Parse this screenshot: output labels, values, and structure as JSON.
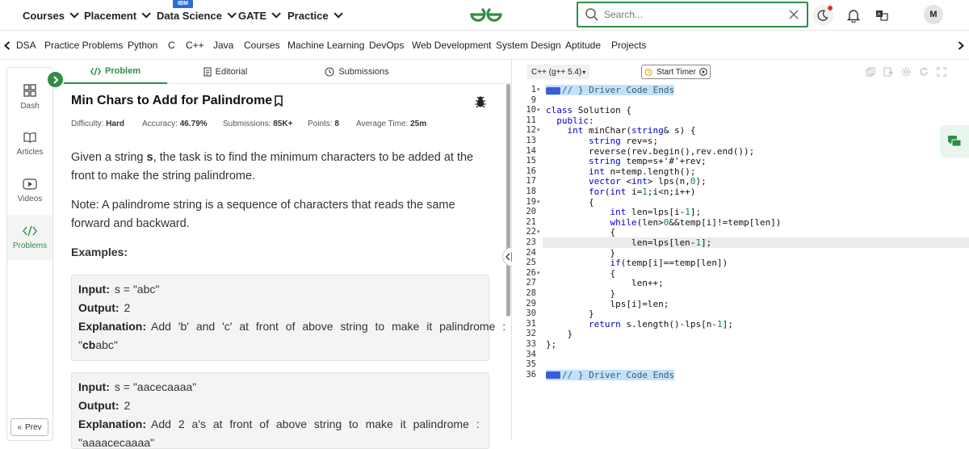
{
  "topnav": {
    "courses": "Courses",
    "placement": "Placement",
    "data_science": "Data Science",
    "ibm": "IBM",
    "gate": "GATE",
    "practice": "Practice",
    "search_placeholder": "Search...",
    "avatar": "M"
  },
  "subnav": [
    "DSA",
    "Practice Problems",
    "Python",
    "C",
    "C++",
    "Java",
    "Courses",
    "Machine Learning",
    "DevOps",
    "Web Development",
    "System Design",
    "Aptitude",
    "Projects"
  ],
  "rail": {
    "dash": "Dash",
    "articles": "Articles",
    "videos": "Videos",
    "problems": "Problems",
    "prev": "Prev"
  },
  "tabs": {
    "problem": "Problem",
    "editorial": "Editorial",
    "submissions": "Submissions"
  },
  "problem": {
    "title": "Min Chars to Add for Palindrome",
    "difficulty_label": "Difficulty:",
    "difficulty": "Hard",
    "accuracy_label": "Accuracy:",
    "accuracy": "46.79%",
    "submissions_label": "Submissions:",
    "submissions": "85K+",
    "points_label": "Points:",
    "points": "8",
    "time_label": "Average Time:",
    "time": "25m",
    "desc_pre": "Given a string ",
    "desc_var": "s",
    "desc_post": ", the task is to find the minimum characters to be added at the front to make the string palindrome.",
    "note": "Note: A palindrome string is a sequence of characters that reads the same forward and backward.",
    "examples_heading": "Examples:",
    "input_label": "Input:",
    "output_label": "Output:",
    "explanation_label": "Explanation:",
    "ex1_input": "s = \"abc\"",
    "ex1_output": "2",
    "ex1_expl": "Add 'b' and 'c' at front of above string to make it palindrome :",
    "ex1_expl2_pre": "\"",
    "ex1_expl2_bold": "cb",
    "ex1_expl2_post": "abc\"",
    "ex2_input": "s = \"aacecaaaa\"",
    "ex2_output": "2",
    "ex2_expl": "Add 2 a's at front of above string to make it palindrome :",
    "ex2_expl2": "\"aaaacecaaaa\""
  },
  "editor": {
    "language": "C++ (g++ 5.4)",
    "timer": "Start Timer",
    "line_numbers": [
      "1",
      "9",
      "10",
      "11",
      "12",
      "13",
      "14",
      "15",
      "16",
      "17",
      "18",
      "19",
      "20",
      "21",
      "22",
      "23",
      "24",
      "25",
      "26",
      "27",
      "28",
      "29",
      "30",
      "31",
      "32",
      "33",
      "34",
      "35",
      "36"
    ],
    "fold_lines": [
      "1",
      "10",
      "12",
      "19",
      "22",
      "26"
    ],
    "code": [
      "// } Driver Code Ends",
      "",
      "class Solution {",
      "  public:",
      "    int minChar(string& s) {",
      "        string rev=s;",
      "        reverse(rev.begin(),rev.end());",
      "        string temp=s+'#'+rev;",
      "        int n=temp.length();",
      "        vector <int> lps(n,0);",
      "        for(int i=1;i<n;i++)",
      "        {",
      "            int len=lps[i-1];",
      "            while(len>0&&temp[i]!=temp[len])",
      "            {",
      "                len=lps[len-1];",
      "            }",
      "            if(temp[i]==temp[len])",
      "            {",
      "                len++;",
      "            }",
      "            lps[i]=len;",
      "        }",
      "        return s.length()-lps[n-1];",
      "    }",
      "};",
      "",
      "",
      "// } Driver Code Ends"
    ]
  }
}
